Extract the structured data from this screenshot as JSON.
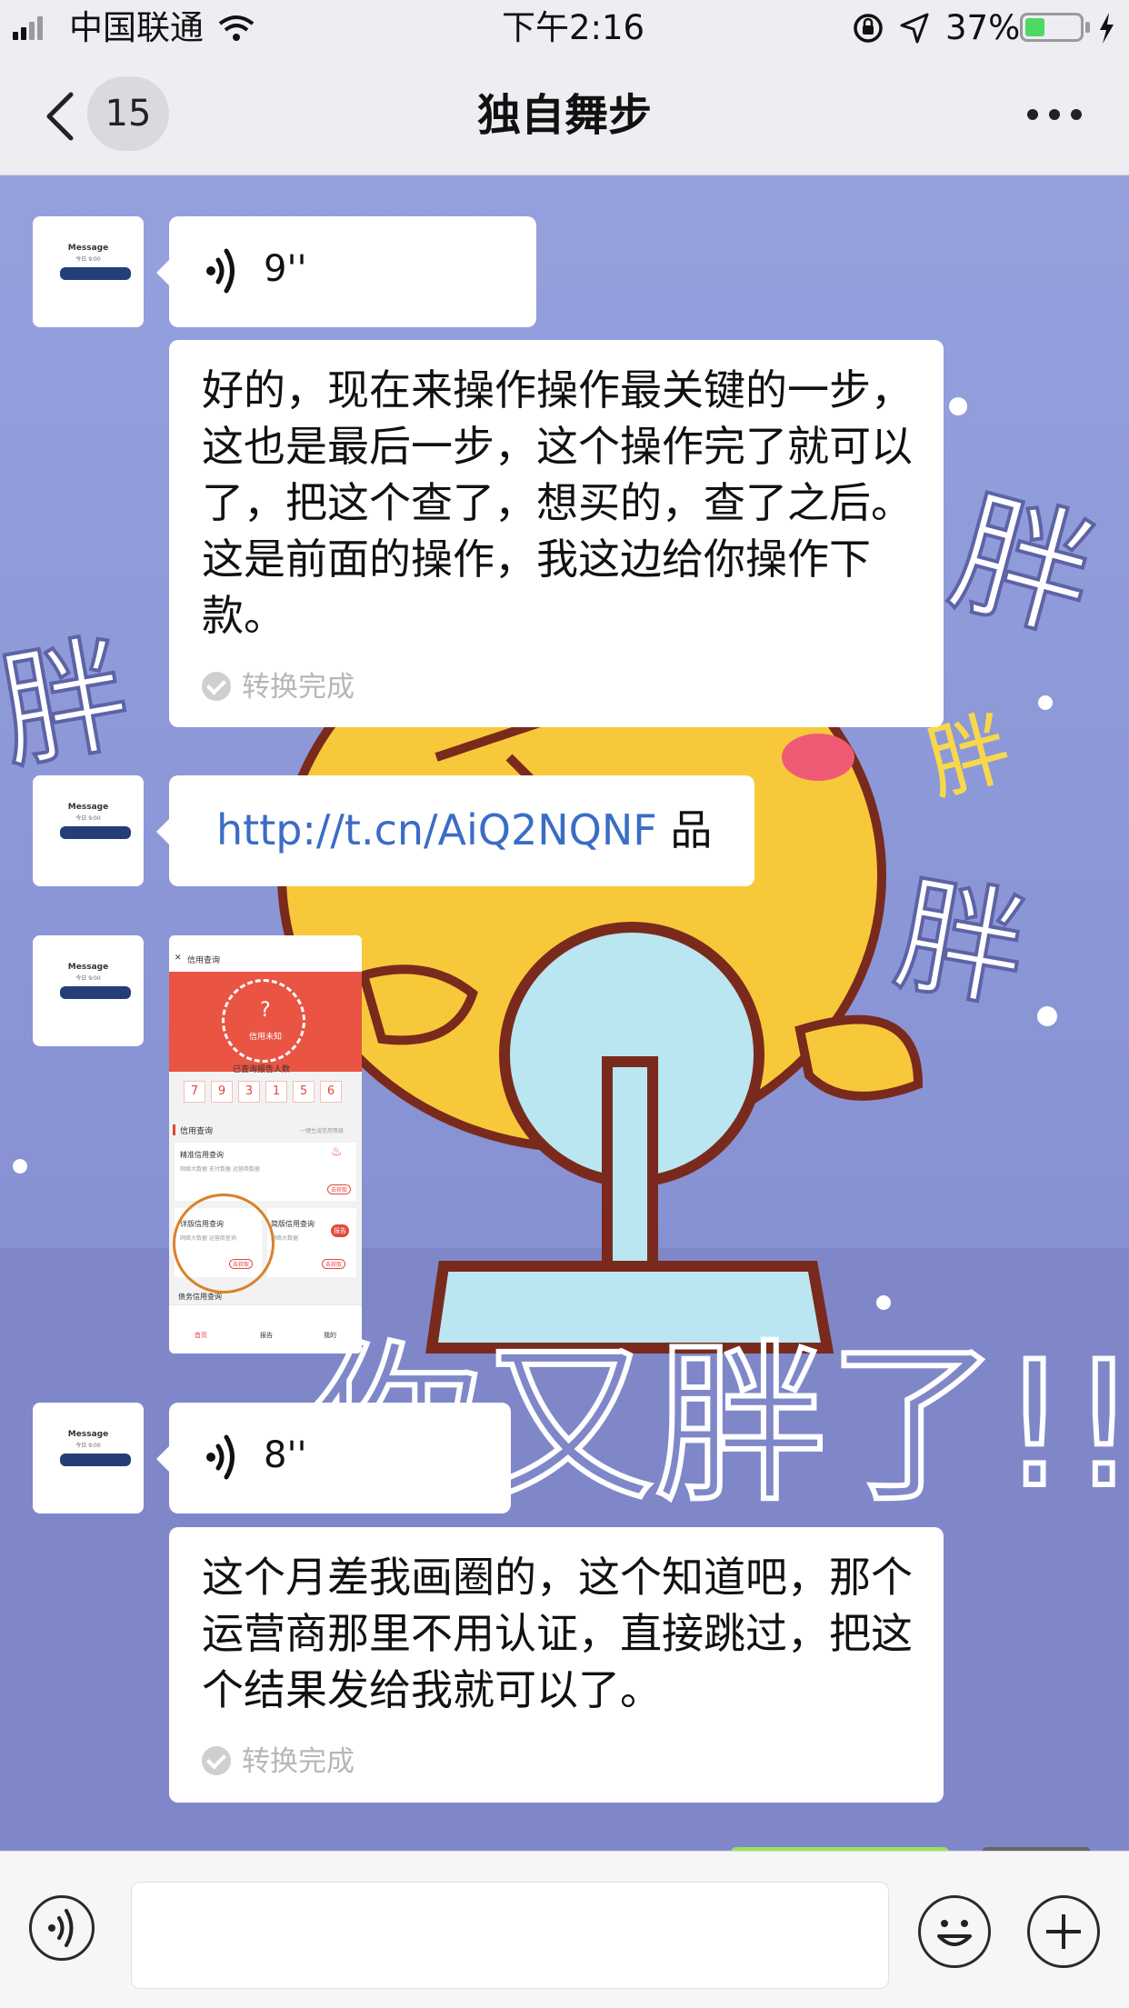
{
  "status_bar": {
    "carrier": "中国联通",
    "time": "下午2:16",
    "battery_percent": "37%",
    "battery_level": 0.37,
    "signal_icon": "signal-bars-icon",
    "wifi_icon": "wifi-icon",
    "lock_icon": "rotation-lock-icon",
    "location_icon": "location-arrow-icon",
    "charging_icon": "charging-bolt-icon"
  },
  "nav": {
    "title": "独自舞步",
    "unread_count": "15",
    "back_icon": "chevron-left-icon",
    "more_icon": "more-dots-icon"
  },
  "messages": [
    {
      "type": "voice",
      "duration": "9''"
    },
    {
      "type": "transcript",
      "text": "好的，现在来操作操作最关键的一步，这也是最后一步，这个操作完了就可以了，把这个查了，想买的，查了之后。这是前面的操作，我这边给你操作下款。",
      "status": "转换完成"
    },
    {
      "type": "link",
      "url": "http://t.cn/AiQ2NQNF",
      "suffix": " 品"
    },
    {
      "type": "image",
      "screenshot": {
        "title": "信用查询",
        "credit_status": "信用未知",
        "report_count_label": "已查询报告人数",
        "digits": [
          "7",
          "9",
          "3",
          "1",
          "5",
          "6"
        ],
        "section_title": "信用查询",
        "section_right": "一键生成信用等级",
        "card1_title": "精准信用查询",
        "card1_sub": "网络大数据 支付数据 运营商数据",
        "card1_btn": "去获取",
        "card2_title": "详版信用查询",
        "card2_sub": "网络大数据 运营商查询",
        "card2_btn": "去获取",
        "card3_title": "简版信用查询",
        "card3_sub": "网络大数据",
        "card3_btn": "去获取",
        "card3_badge": "报告",
        "card4_title": "债务信用查询",
        "tab_home": "首页",
        "tab_report": "报告",
        "tab_mine": "我的"
      }
    },
    {
      "type": "voice",
      "duration": "8''"
    },
    {
      "type": "transcript",
      "text": "这个月差我画圈的，这个知道吧，那个运营商那里不用认证，直接跳过，把这个结果发给我就可以了。",
      "status": "转换完成"
    }
  ],
  "avatar": {
    "line1": "Message",
    "line2": "今日 9:00"
  },
  "wallpaper": {
    "sticker_text": "胖",
    "caption": "你又胖了!!"
  },
  "input_bar": {
    "voice_icon": "voice-mode-icon",
    "emoji_icon": "emoji-icon",
    "plus_icon": "plus-icon",
    "text_value": ""
  },
  "colors": {
    "link": "#3b6cc6",
    "wallpaper_bg": "#8f98d6",
    "cat_yellow": "#f7c93a",
    "nav_bg": "#ededf2"
  }
}
